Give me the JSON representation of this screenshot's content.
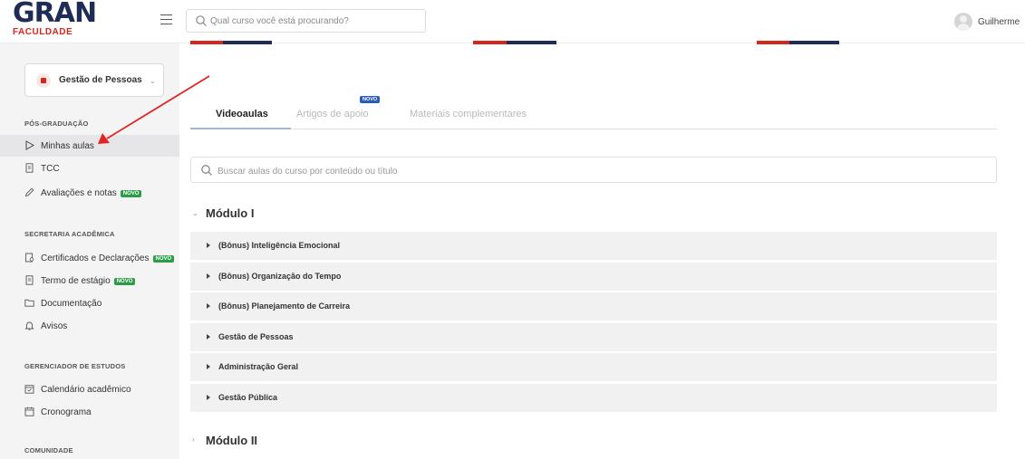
{
  "header": {
    "logo_main": "GRAN",
    "logo_sub": "FACULDADE",
    "search_placeholder": "Qual curso você está procurando?",
    "user_name": "Guilherme"
  },
  "sidebar": {
    "course_name": "Gestão de Pessoas",
    "sections": [
      {
        "title": "PÓS-GRADUAÇÃO",
        "items": [
          {
            "label": "Minhas aulas",
            "icon": "play-outline-icon",
            "active": true,
            "badge": ""
          },
          {
            "label": "TCC",
            "icon": "document-icon",
            "active": false,
            "badge": ""
          },
          {
            "label": "Avaliações e notas",
            "icon": "pencil-icon",
            "active": false,
            "badge": "NOVO"
          }
        ]
      },
      {
        "title": "SECRETARIA ACADÊMICA",
        "items": [
          {
            "label": "Certificados e Declarações",
            "icon": "certificate-icon",
            "active": false,
            "badge": "NOVO"
          },
          {
            "label": "Termo de estágio",
            "icon": "document-icon",
            "active": false,
            "badge": "NOVO"
          },
          {
            "label": "Documentação",
            "icon": "folder-icon",
            "active": false,
            "badge": ""
          },
          {
            "label": "Avisos",
            "icon": "bell-icon",
            "active": false,
            "badge": ""
          }
        ]
      },
      {
        "title": "GERENCIADOR DE ESTUDOS",
        "items": [
          {
            "label": "Calendário acadêmico",
            "icon": "calendar-check-icon",
            "active": false,
            "badge": ""
          },
          {
            "label": "Cronograma",
            "icon": "calendar-icon",
            "active": false,
            "badge": ""
          }
        ]
      },
      {
        "title": "COMUNIDADE",
        "items": []
      }
    ]
  },
  "main": {
    "tabs": [
      {
        "label": "Videoaulas",
        "active": true
      },
      {
        "label": "Artigos de apoio",
        "active": false,
        "badge": "NOVO"
      },
      {
        "label": "Materiais complementares",
        "active": false
      }
    ],
    "search_placeholder": "Buscar aulas do curso por conteúdo ou título",
    "modules": [
      {
        "title": "Módulo I",
        "expanded": true,
        "lessons": [
          "(Bônus) Inteligência Emocional",
          "(Bônus) Organização do Tempo",
          "(Bônus) Planejamento de Carreira",
          "Gestão de Pessoas",
          "Administração Geral",
          "Gestão Pública"
        ]
      },
      {
        "title": "Módulo II",
        "expanded": false,
        "lessons": []
      }
    ]
  },
  "colors": {
    "brand_navy": "#1f2c55",
    "brand_red": "#d4271d",
    "badge_green": "#2e9b48",
    "badge_blue": "#2f5bb8",
    "annotation_arrow": "#e02424"
  }
}
